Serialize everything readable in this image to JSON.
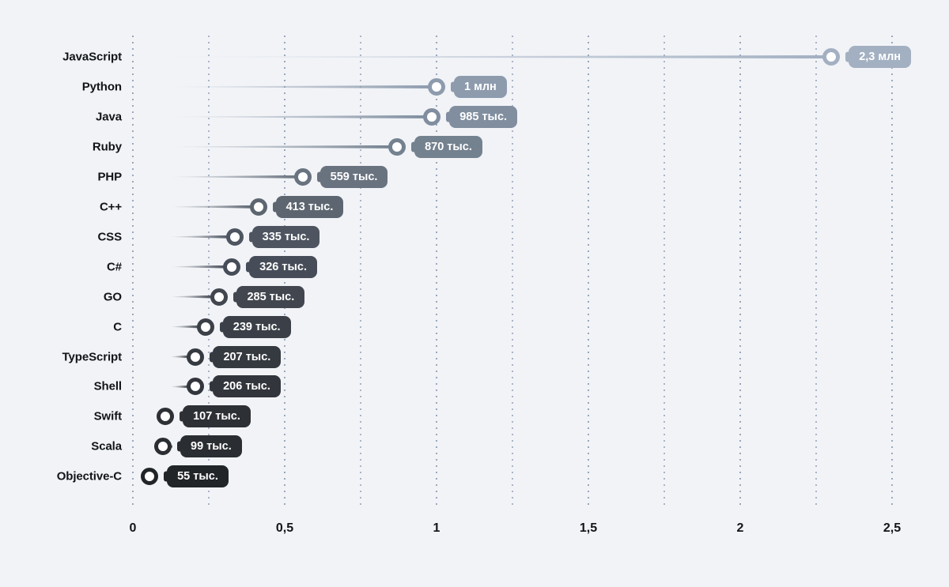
{
  "chart_data": {
    "type": "bar",
    "variant": "lollipop-horizontal",
    "title": "",
    "subtitle": "",
    "xlabel": "",
    "ylabel": "",
    "xlim": [
      0,
      2.6
    ],
    "xunit": "млн",
    "grid": true,
    "legend": false,
    "background_color": "#f1f3f7",
    "categories": [
      "JavaScript",
      "Python",
      "Java",
      "Ruby",
      "PHP",
      "C++",
      "CSS",
      "C#",
      "GO",
      "C",
      "TypeScript",
      "Shell",
      "Swift",
      "Scala",
      "Objective-C"
    ],
    "values": [
      2.3,
      1.0,
      0.985,
      0.87,
      0.559,
      0.413,
      0.335,
      0.326,
      0.285,
      0.239,
      0.207,
      0.206,
      0.107,
      0.099,
      0.055
    ],
    "value_labels": [
      "2,3 млн",
      "1 млн",
      "985 тыс.",
      "870 тыс.",
      "559 тыс.",
      "413 тыс.",
      "335 тыс.",
      "326 тыс.",
      "285 тыс.",
      "239 тыс.",
      "207 тыс.",
      "206 тыс.",
      "107 тыс.",
      "99 тыс.",
      "55 тыс."
    ],
    "series_colors": [
      "#a3b0c2",
      "#8d9bad",
      "#808e9f",
      "#74818f",
      "#69737f",
      "#5d6670",
      "#4e5561",
      "#474d58",
      "#41464f",
      "#3b4048",
      "#353940",
      "#32363c",
      "#2d3035",
      "#2a2d31",
      "#222528"
    ],
    "xticks": [
      {
        "value": 0,
        "label": "0"
      },
      {
        "value": 0.5,
        "label": "0,5"
      },
      {
        "value": 1,
        "label": "1"
      },
      {
        "value": 1.5,
        "label": "1,5"
      },
      {
        "value": 2,
        "label": "2"
      },
      {
        "value": 2.5,
        "label": "2,5"
      }
    ],
    "minor_gridlines": [
      0.25,
      0.75,
      1.25,
      1.75,
      2.25
    ],
    "axis_label_color": "#111418",
    "gridline_color": "#9aa7bb"
  }
}
